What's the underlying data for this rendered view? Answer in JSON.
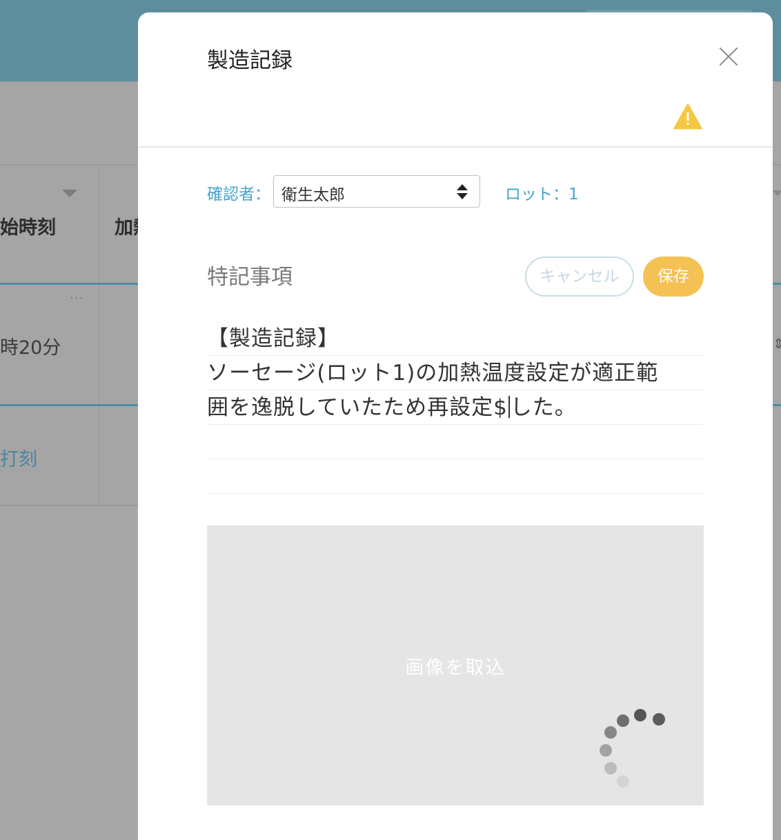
{
  "background": {
    "columns": [
      {
        "label": "始時刻"
      },
      {
        "label": "加熱"
      }
    ],
    "row1": {
      "time": "時20分",
      "menu": "···"
    },
    "row2": {
      "link": "打刻"
    }
  },
  "modal": {
    "title": "製造記録",
    "reviewer": {
      "label": "確認者：",
      "selected": "衛生太郎"
    },
    "lot": "ロット：1",
    "notes": {
      "heading": "特記事項",
      "cancel_label": "キャンセル",
      "save_label": "保存",
      "lines": [
        "【製造記録】",
        "ソーセージ(ロット1)の加熱温度設定が適正範",
        "囲を逸脱していたため再設定$",
        "した。",
        "",
        ""
      ]
    },
    "image_import": {
      "label": "画像を取込"
    }
  },
  "colors": {
    "accent": "#45a5c9",
    "save": "#f4c152",
    "warning": "#f5c842",
    "header": "#5e8e9d"
  },
  "icons": [
    "close-icon",
    "warning-icon",
    "updown-icon",
    "spinner-icon",
    "more-icon"
  ]
}
